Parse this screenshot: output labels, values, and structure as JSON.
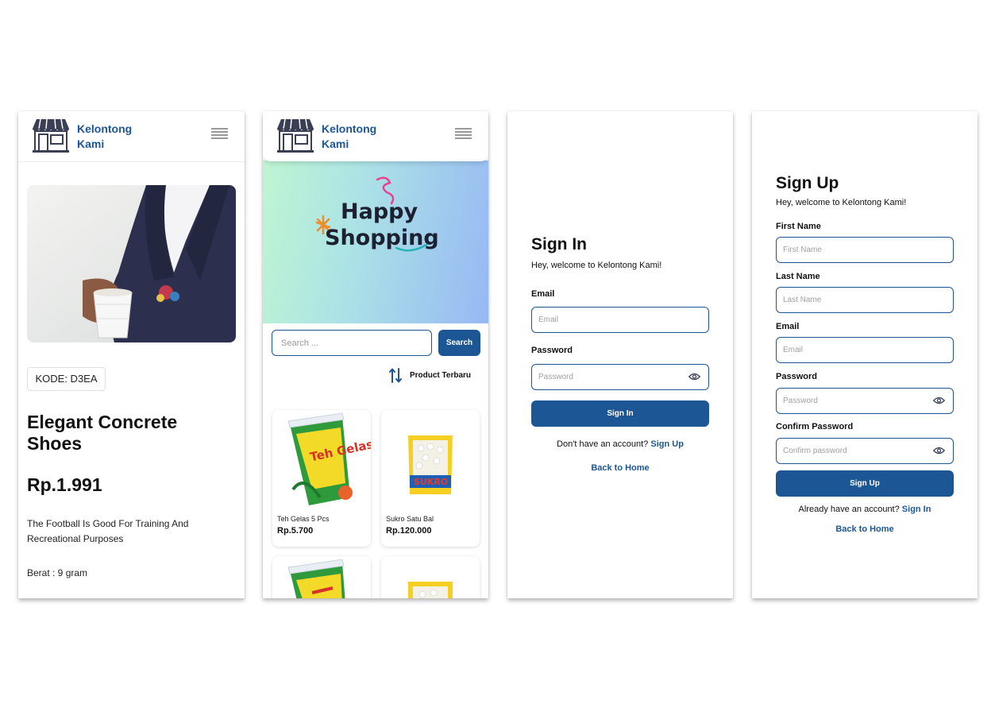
{
  "brand": {
    "name_line1": "Kelontong",
    "name_line2": "Kami",
    "logo_icon": "store-awning-icon",
    "menu_icon": "hamburger-menu-icon",
    "primary_color": "#1d5694"
  },
  "product_detail": {
    "image": "man-in-suit-holding-cup-photo",
    "code": "KODE: D3EA",
    "name": "Elegant Concrete Shoes",
    "price": "Rp.1.991",
    "description": "The Football Is Good For Training And Recreational Purposes",
    "weight": "Berat : 9 gram"
  },
  "home": {
    "banner_text_line1": "Happy",
    "banner_text_line2": "Shopping",
    "search": {
      "placeholder": "Search ...",
      "button_label": "Search"
    },
    "sort": {
      "icon": "sort-arrows-icon",
      "label": "Product Terbaru"
    },
    "products": [
      {
        "name": "Teh Gelas 5 Pcs",
        "price": "Rp.5.700",
        "image": "teh-gelas-cup"
      },
      {
        "name": "Sukro Satu Bal",
        "price": "Rp.120.000",
        "image": "sukro-snack-bag"
      },
      {
        "name": "",
        "price": "",
        "image": "teh-gelas-cup"
      },
      {
        "name": "",
        "price": "",
        "image": "sukro-snack-bag"
      }
    ],
    "product_label_teh": "Teh Gelas",
    "product_label_sukro": "SUKRO"
  },
  "sign_in": {
    "title": "Sign In",
    "subtitle": "Hey, welcome to Kelontong Kami!",
    "email_label": "Email",
    "email_placeholder": "Email",
    "password_label": "Password",
    "password_placeholder": "Password",
    "submit_label": "Sign In",
    "prompt_text": "Don't have an account?",
    "prompt_link": "Sign Up",
    "back_label": "Back to Home"
  },
  "sign_up": {
    "title": "Sign Up",
    "subtitle": "Hey, welcome to Kelontong Kami!",
    "first_name_label": "First Name",
    "first_name_placeholder": "First Name",
    "last_name_label": "Last Name",
    "last_name_placeholder": "Last Name",
    "email_label": "Email",
    "email_placeholder": "Email",
    "password_label": "Password",
    "password_placeholder": "Password",
    "confirm_label": "Confirm Password",
    "confirm_placeholder": "Confirm password",
    "submit_label": "Sign Up",
    "prompt_text": "Already have an account?",
    "prompt_link": "Sign In",
    "back_label": "Back to Home"
  }
}
